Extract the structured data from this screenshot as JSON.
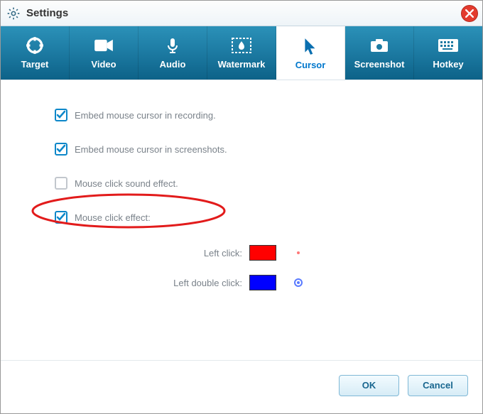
{
  "window": {
    "title": "Settings"
  },
  "tabs": {
    "target": "Target",
    "video": "Video",
    "audio": "Audio",
    "watermark": "Watermark",
    "cursor": "Cursor",
    "screenshot": "Screenshot",
    "hotkey": "Hotkey"
  },
  "options": {
    "embed_recording": {
      "label": "Embed mouse cursor in recording.",
      "checked": true
    },
    "embed_screenshot": {
      "label": "Embed mouse cursor in screenshots.",
      "checked": true
    },
    "click_sound": {
      "label": "Mouse click sound effect.",
      "checked": false
    },
    "click_effect": {
      "label": "Mouse click effect:",
      "checked": true
    }
  },
  "colors": {
    "left_click": {
      "label": "Left click:",
      "value": "#ff0000"
    },
    "left_double_click": {
      "label": "Left double click:",
      "value": "#0000ff"
    }
  },
  "buttons": {
    "ok": "OK",
    "cancel": "Cancel"
  },
  "annotation": {
    "highlight": "click_sound"
  }
}
